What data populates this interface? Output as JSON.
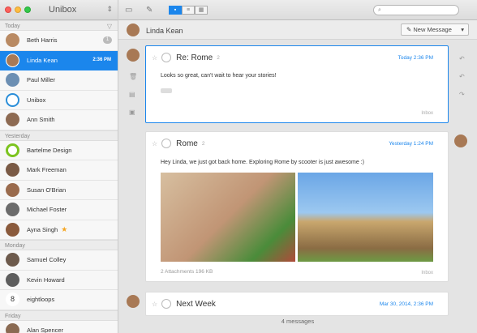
{
  "app": {
    "title": "Unibox"
  },
  "sidebar": {
    "sections": [
      {
        "label": "Today",
        "contacts": [
          {
            "name": "Beth Harris",
            "badge": "1",
            "color": "#b98a63"
          },
          {
            "name": "Linda Kean",
            "time": "2:36 PM",
            "selected": true,
            "color": "#a87955"
          },
          {
            "name": "Paul Miller",
            "color": "#6c8fb3"
          },
          {
            "name": "Unibox",
            "color": "#2a8ed9"
          },
          {
            "name": "Ann Smith",
            "color": "#8d6a52"
          }
        ]
      },
      {
        "label": "Yesterday",
        "contacts": [
          {
            "name": "Bartelme Design",
            "color": "#7cc41f"
          },
          {
            "name": "Mark Freeman",
            "color": "#7a5a45"
          },
          {
            "name": "Susan O'Brian",
            "color": "#9a6b4d"
          },
          {
            "name": "Michael Foster",
            "color": "#6b6b6b"
          },
          {
            "name": "Ayna Singh",
            "star": true,
            "color": "#8a5a3c"
          }
        ]
      },
      {
        "label": "Monday",
        "contacts": [
          {
            "name": "Samuel Colley",
            "color": "#6d5a4c"
          },
          {
            "name": "Kevin Howard",
            "color": "#5e5e5e"
          },
          {
            "name": "eightloops",
            "color": "#cccccc"
          }
        ]
      },
      {
        "label": "Friday",
        "contacts": [
          {
            "name": "Alan Spencer",
            "color": "#8a6a52"
          }
        ]
      }
    ]
  },
  "toolbar": {
    "search_placeholder": ""
  },
  "conversation": {
    "name": "Linda Kean",
    "new_message_label": "New Message",
    "messages": [
      {
        "subject": "Re: Rome",
        "replies": "2",
        "date": "Today 2:36 PM",
        "body": "Looks so great, can't wait to hear your stories!",
        "inbox": "Inbox"
      },
      {
        "subject": "Rome",
        "replies": "2",
        "date": "Yesterday 1:24 PM",
        "body": "Hey Linda, we just got back home. Exploring Rome by scooter is just awesome :)",
        "attachments": "2 Attachments",
        "attachment_size": "196 KB",
        "inbox": "Inbox"
      },
      {
        "subject": "Next Week",
        "date": "Mar 30, 2014, 2:36 PM"
      }
    ],
    "status": "4 messages"
  },
  "colors": {
    "accent": "#1b86ec",
    "selected_row": "#1b86ec",
    "star": "#f5a623"
  }
}
